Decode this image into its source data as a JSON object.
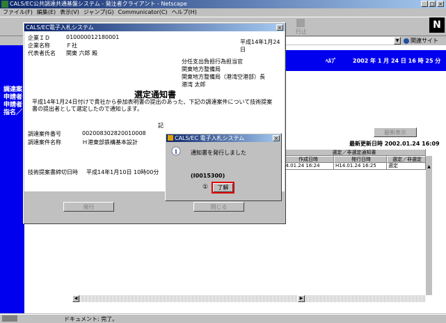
{
  "browser": {
    "title": "CALS/EC公共調達共通基盤システム - 発注者クライアント - Netscape",
    "menu": [
      "ファイル(F)",
      "編集(E)",
      "表示(V)",
      "ジャンプ(G)",
      "Communicator(C)",
      "ヘルプ(H)"
    ],
    "related_sites": "関連サイト",
    "status_text": "ドキュメント: 完了。",
    "toolbar_label": "行止"
  },
  "page": {
    "help_label": "ﾍﾙﾌﾟ",
    "datetime": "2002 年  1 月 24 日  16 時 25 分",
    "left_labels": [
      "調達案",
      "申請者",
      "申請者",
      "指名／"
    ],
    "reload_button": "最新表示",
    "last_updated": "最新更新日時 2002.01.24 16:09",
    "table_title": "選定／非選定通知書",
    "table_headers": [
      "作成日時",
      "発行日時",
      "選定／非選定"
    ],
    "table_row": [
      "14.01.24 16:24",
      "H14.01.24 16:25",
      "選定"
    ]
  },
  "notice_window": {
    "title": "CALS/EC電子入札システム",
    "company_id_label": "企業ＩＤ",
    "company_id": "010000012180001",
    "company_name_label": "企業名称",
    "company_name": "Ｆ社",
    "representative_label": "代表者氏名",
    "representative": "関東 六郎  殿",
    "date": "平成14年1月24日",
    "sender_lines": [
      "分任支出負担行為担当官",
      "関東地方整備局",
      "関東地方整備局（港湾空港部）長",
      "港湾  太郎"
    ],
    "heading": "選定通知書",
    "body_lines": [
      "平成14年1月24日付けで貴社から参加表明書の提出のあった、下記の調達案件について技術提案",
      "書の提出者として選定したので通知します。"
    ],
    "ki": "記",
    "case_number_label": "調達案件番号",
    "case_number": "002008302820010008",
    "case_name_label": "調達案件名称",
    "case_name": "Ｈ港東部鉄構基本設計",
    "deadline_label": "技術提案書締切日時",
    "deadline": "平成14年1月10日 10時00分",
    "issue_button": "発行",
    "close_button": "閉じる"
  },
  "alert": {
    "title": "CALS/EC 電子入札システム",
    "message": "通知書を発行しました",
    "code": "(I0015300)",
    "ok_button": "了解"
  }
}
